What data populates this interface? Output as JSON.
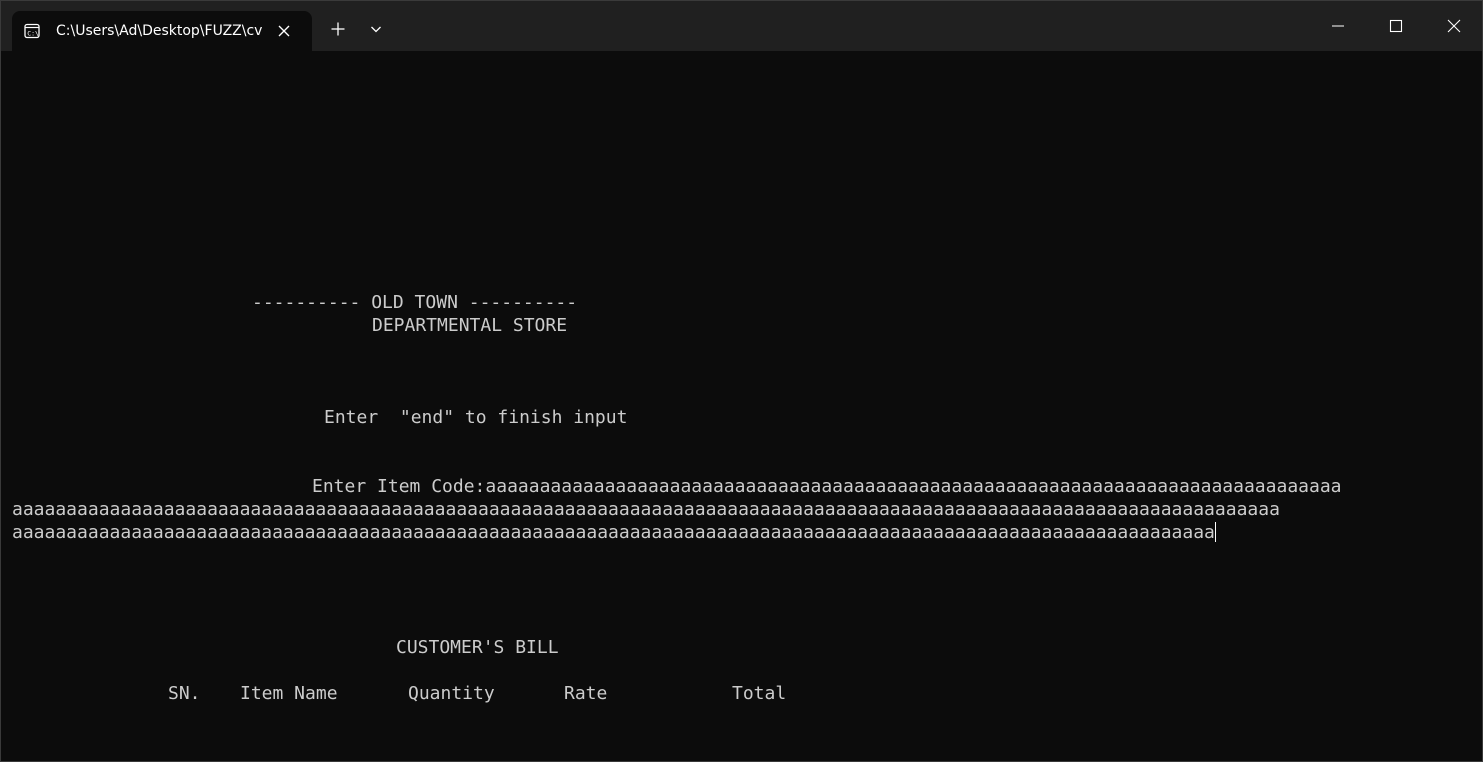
{
  "window": {
    "tab_title": "C:\\Users\\Ad\\Desktop\\FUZZ\\cv",
    "icons": {
      "tab": "terminal-icon",
      "close_tab": "close-icon",
      "new_tab": "plus-icon",
      "dropdown": "chevron-down-icon",
      "minimize": "minimize-icon",
      "maximize": "maximize-icon",
      "close": "close-icon"
    }
  },
  "terminal": {
    "header_line1": "---------- OLD TOWN ----------",
    "header_line2": "DEPARTMENTAL STORE",
    "instruction": "Enter  \"end\" to finish input",
    "prompt_label": "Enter Item Code:",
    "input_line1": "aaaaaaaaaaaaaaaaaaaaaaaaaaaaaaaaaaaaaaaaaaaaaaaaaaaaaaaaaaaaaaaaaaaaaaaaaaaaaaa",
    "input_line2": "aaaaaaaaaaaaaaaaaaaaaaaaaaaaaaaaaaaaaaaaaaaaaaaaaaaaaaaaaaaaaaaaaaaaaaaaaaaaaaaaaaaaaaaaaaaaaaaaaaaaaaaaaaaaaaaaaaaaa",
    "input_line3": "aaaaaaaaaaaaaaaaaaaaaaaaaaaaaaaaaaaaaaaaaaaaaaaaaaaaaaaaaaaaaaaaaaaaaaaaaaaaaaaaaaaaaaaaaaaaaaaaaaaaaaaaaaaaaaa",
    "bill_title": "CUSTOMER'S BILL",
    "columns": [
      "SN.",
      "Item Name",
      "Quantity",
      "Rate",
      "Total"
    ]
  },
  "colors": {
    "background": "#0c0c0c",
    "titlebar": "#202020",
    "text": "#cccccc"
  }
}
